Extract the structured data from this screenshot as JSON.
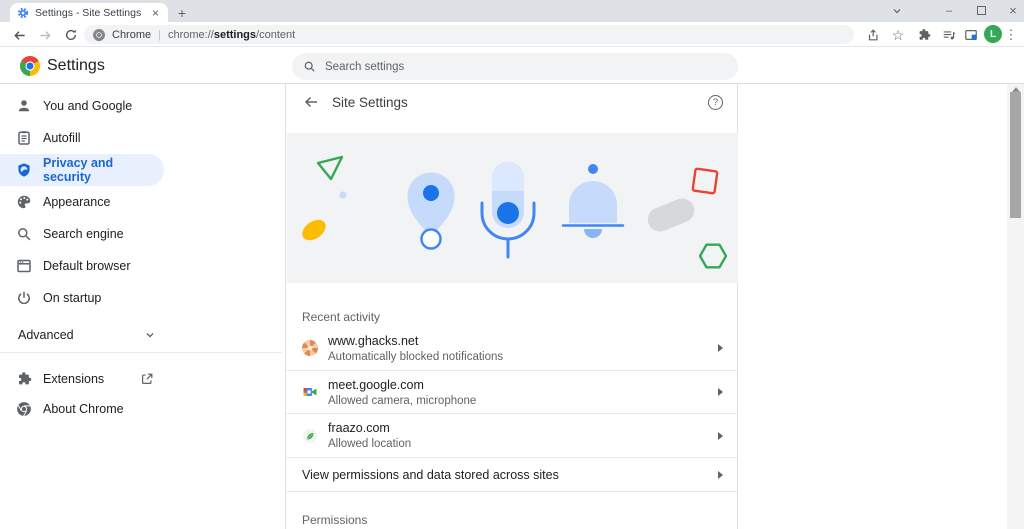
{
  "browser": {
    "tab": {
      "title": "Settings - Site Settings",
      "close_glyph": "×"
    },
    "new_tab_glyph": "+",
    "window_controls": {
      "minimize_glyph": "–",
      "close_glyph": "×"
    },
    "toolbar": {
      "url_app": "Chrome",
      "url_separator": "|",
      "url_scheme": "chrome://",
      "url_host": "settings",
      "url_path": "/content",
      "avatar_letter": "L",
      "menu_dots_glyph": "⋮",
      "bookmark_star_glyph": "☆"
    }
  },
  "settings_header": {
    "title": "Settings",
    "search_placeholder": "Search settings"
  },
  "sidebar": {
    "items": [
      {
        "label": "You and Google"
      },
      {
        "label": "Autofill"
      },
      {
        "label": "Privacy and security"
      },
      {
        "label": "Appearance"
      },
      {
        "label": "Search engine"
      },
      {
        "label": "Default browser"
      },
      {
        "label": "On startup"
      }
    ],
    "advanced_label": "Advanced",
    "extensions_label": "Extensions",
    "about_label": "About Chrome"
  },
  "page": {
    "title": "Site Settings",
    "help_glyph": "?",
    "recent_activity": {
      "label": "Recent activity",
      "rows": [
        {
          "site": "www.ghacks.net",
          "description": "Automatically blocked notifications"
        },
        {
          "site": "meet.google.com",
          "description": "Allowed camera, microphone"
        },
        {
          "site": "fraazo.com",
          "description": "Allowed location"
        }
      ]
    },
    "view_permissions_label": "View permissions and data stored across sites",
    "permissions_label": "Permissions"
  },
  "colors": {
    "accent_blue": "#1a73e8",
    "selected_text": "#1967d2",
    "selected_bg": "#e8f0fe",
    "banner_bg": "#f1f3f4",
    "avatar_green": "#34a853",
    "frame_gray": "#dee1e6"
  }
}
